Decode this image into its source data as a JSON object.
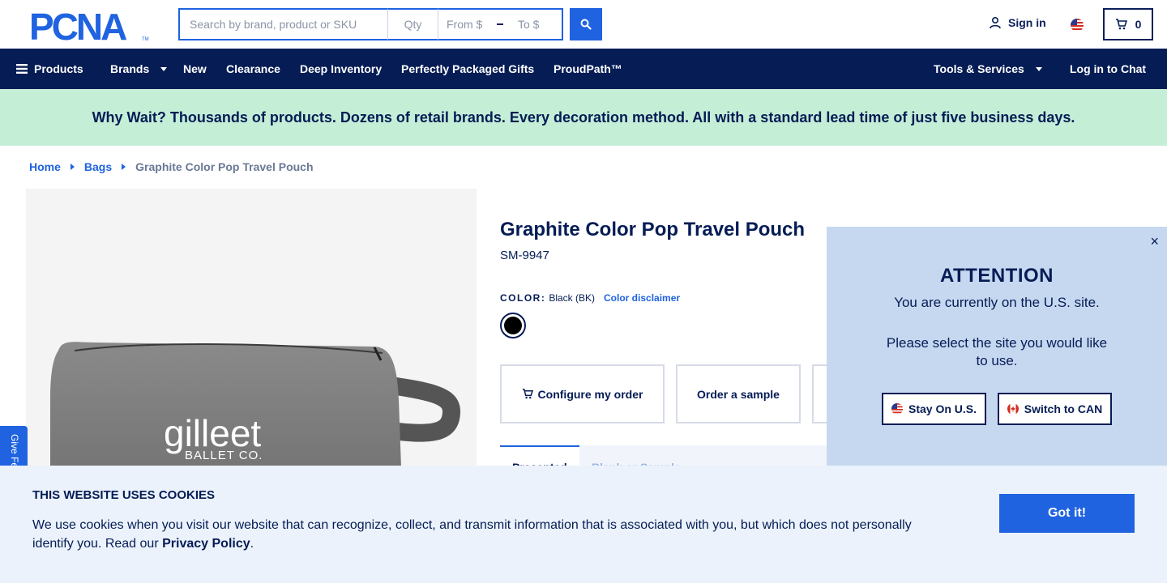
{
  "header": {
    "logo_text": "PCNA",
    "search": {
      "placeholder": "Search by brand, product or SKU",
      "qty_placeholder": "Qty",
      "price_from_placeholder": "From $",
      "price_to_placeholder": "To $"
    },
    "sign_in_label": "Sign in",
    "cart_count": "0"
  },
  "nav": {
    "products": "Products",
    "brands": "Brands",
    "new": "New",
    "clearance": "Clearance",
    "deep_inventory": "Deep Inventory",
    "gifts": "Perfectly Packaged Gifts",
    "proudpath": "ProudPath™",
    "tools": "Tools & Services",
    "chat": "Log in to Chat"
  },
  "promo": {
    "text": "Why Wait? Thousands of products. Dozens of retail brands. Every decoration method. All with a standard lead time of just five business days."
  },
  "breadcrumb": {
    "home": "Home",
    "category": "Bags",
    "current": "Graphite Color Pop Travel Pouch"
  },
  "product": {
    "title": "Graphite Color Pop Travel Pouch",
    "sku": "SM-9947",
    "color_label": "COLOR:",
    "color_value": "Black (BK)",
    "color_disclaimer": "Color disclaimer",
    "swatch_color": "#000000",
    "image_brand_main": "gilleet",
    "image_brand_sub": "BALLET CO.",
    "buttons": {
      "configure": "Configure my order",
      "sample": "Order a sample"
    },
    "tabs": {
      "first": "Presented",
      "second": "Blank or Sample"
    }
  },
  "attention_modal": {
    "close": "×",
    "heading": "ATTENTION",
    "line1": "You are currently on the U.S. site.",
    "line2": "Please select the site you would like to use.",
    "stay_us": "Stay On U.S.",
    "switch_can": "Switch to CAN"
  },
  "feedback": {
    "label": "Give Feedback"
  },
  "cookie_banner": {
    "title": "THIS WEBSITE USES COOKIES",
    "text": "We use cookies when you visit our website that can recognize, collect, and transmit information that is associated with you, but which does not personally identify you. Read our",
    "privacy_link": "Privacy Policy",
    "text_end": ".",
    "button": "Got it!"
  },
  "colors": {
    "navy": "#051c55",
    "accent_blue": "#1f63e0",
    "promo_green": "#c5eed7",
    "modal_blue": "#c6d8f0",
    "cookie_bg": "#ebf2fb"
  }
}
